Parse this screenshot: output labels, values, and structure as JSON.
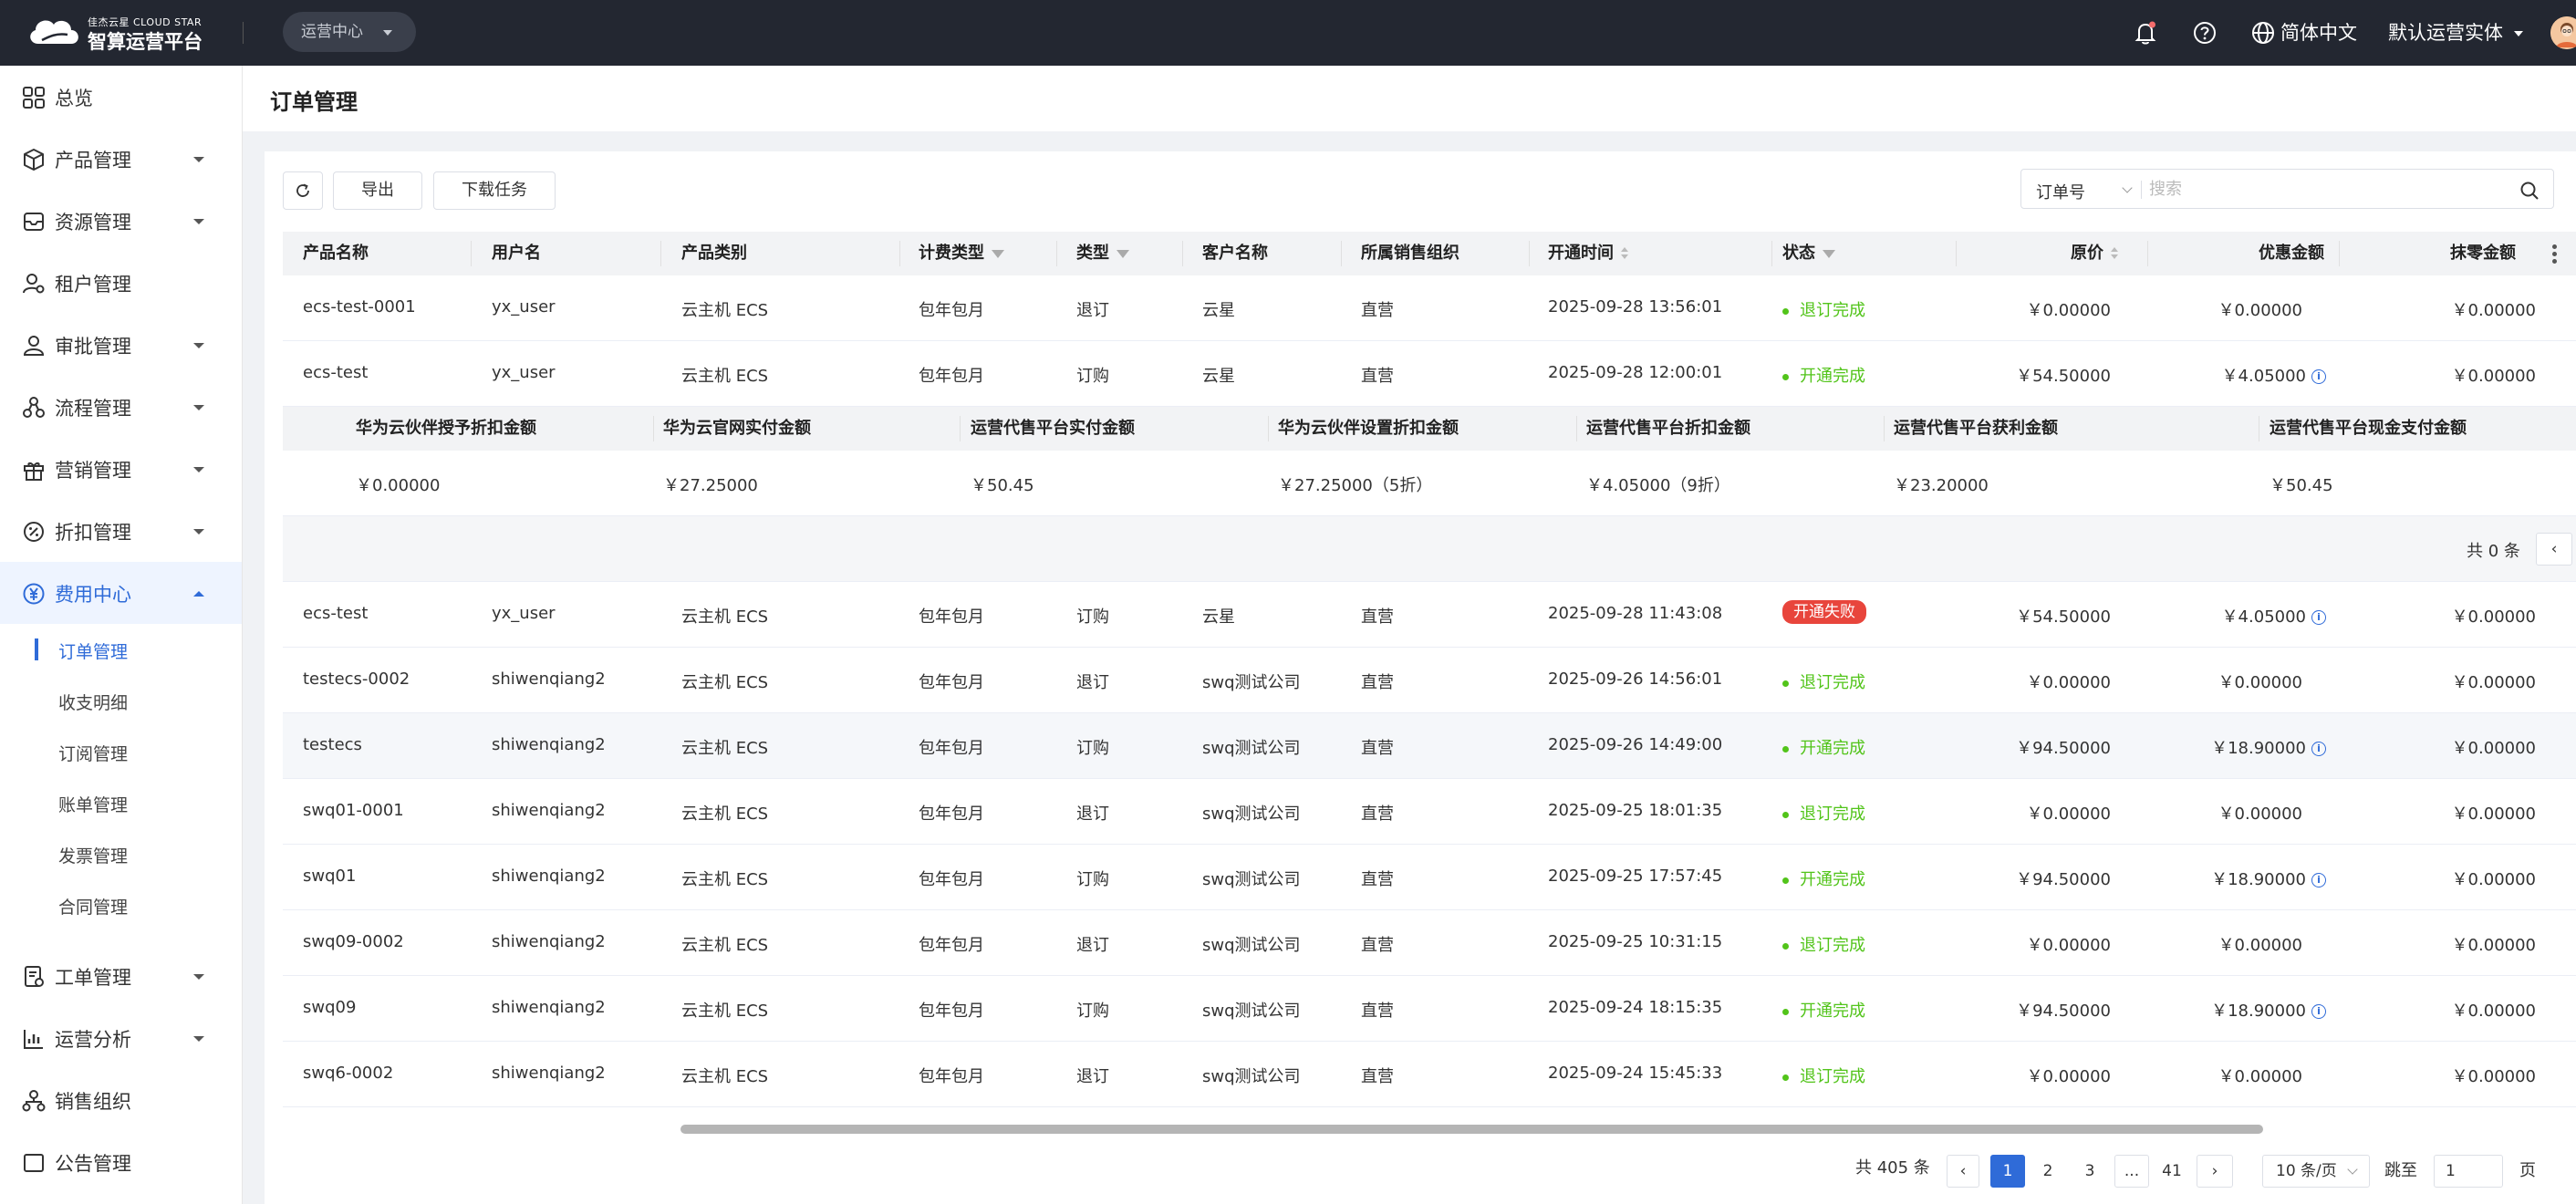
{
  "header": {
    "brand_small": "佳杰云星 CLOUD STAR",
    "brand_name": "智算运营平台",
    "center_switch": "运营中心",
    "language": "简体中文",
    "entity": "默认运营实体"
  },
  "sidebar": {
    "items": [
      {
        "label": "总览",
        "icon": "grid-icon"
      },
      {
        "label": "产品管理",
        "icon": "box-icon"
      },
      {
        "label": "资源管理",
        "icon": "resource-icon"
      },
      {
        "label": "租户管理",
        "icon": "tenant-icon"
      },
      {
        "label": "审批管理",
        "icon": "user-icon"
      },
      {
        "label": "流程管理",
        "icon": "flow-icon"
      },
      {
        "label": "营销管理",
        "icon": "gift-icon"
      },
      {
        "label": "折扣管理",
        "icon": "discount-icon"
      },
      {
        "label": "费用中心",
        "icon": "yen-icon"
      },
      {
        "label": "工单管理",
        "icon": "ticket-icon"
      },
      {
        "label": "运营分析",
        "icon": "chart-icon"
      },
      {
        "label": "销售组织",
        "icon": "org-icon"
      },
      {
        "label": "公告管理",
        "icon": "notice-icon"
      }
    ],
    "sub_items": [
      "订单管理",
      "收支明细",
      "订阅管理",
      "账单管理",
      "发票管理",
      "合同管理"
    ]
  },
  "page": {
    "title": "订单管理"
  },
  "toolbar": {
    "export_label": "导出",
    "download_label": "下载任务",
    "search_type": "订单号",
    "search_placeholder": "搜索"
  },
  "table": {
    "columns": [
      "产品名称",
      "用户名",
      "产品类别",
      "计费类型",
      "类型",
      "客户名称",
      "所属销售组织",
      "开通时间",
      "状态",
      "原价",
      "优惠金额",
      "抹零金额"
    ],
    "rows": [
      {
        "name": "ecs-test-0001",
        "user": "yx_user",
        "category": "云主机 ECS",
        "billing": "包年包月",
        "type": "退订",
        "customer": "云星",
        "org": "直营",
        "time": "2025-09-28 13:56:01",
        "status": "退订完成",
        "price": "￥0.00000",
        "discount": "￥0.00000",
        "rounding": "￥0.00000"
      },
      {
        "name": "ecs-test",
        "user": "yx_user",
        "category": "云主机 ECS",
        "billing": "包年包月",
        "type": "订购",
        "customer": "云星",
        "org": "直营",
        "time": "2025-09-28 12:00:01",
        "status": "开通完成",
        "price": "￥54.50000",
        "discount": "￥4.05000",
        "rounding": "￥0.00000"
      },
      {
        "name": "ecs-test",
        "user": "yx_user",
        "category": "云主机 ECS",
        "billing": "包年包月",
        "type": "订购",
        "customer": "云星",
        "org": "直营",
        "time": "2025-09-28 11:43:08",
        "status": "开通失败",
        "price": "￥54.50000",
        "discount": "￥4.05000",
        "rounding": "￥0.00000"
      },
      {
        "name": "testecs-0002",
        "user": "shiwenqiang2",
        "category": "云主机 ECS",
        "billing": "包年包月",
        "type": "退订",
        "customer": "swq测试公司",
        "org": "直营",
        "time": "2025-09-26 14:56:01",
        "status": "退订完成",
        "price": "￥0.00000",
        "discount": "￥0.00000",
        "rounding": "￥0.00000"
      },
      {
        "name": "testecs",
        "user": "shiwenqiang2",
        "category": "云主机 ECS",
        "billing": "包年包月",
        "type": "订购",
        "customer": "swq测试公司",
        "org": "直营",
        "time": "2025-09-26 14:49:00",
        "status": "开通完成",
        "price": "￥94.50000",
        "discount": "￥18.90000",
        "rounding": "￥0.00000"
      },
      {
        "name": "swq01-0001",
        "user": "shiwenqiang2",
        "category": "云主机 ECS",
        "billing": "包年包月",
        "type": "退订",
        "customer": "swq测试公司",
        "org": "直营",
        "time": "2025-09-25 18:01:35",
        "status": "退订完成",
        "price": "￥0.00000",
        "discount": "￥0.00000",
        "rounding": "￥0.00000"
      },
      {
        "name": "swq01",
        "user": "shiwenqiang2",
        "category": "云主机 ECS",
        "billing": "包年包月",
        "type": "订购",
        "customer": "swq测试公司",
        "org": "直营",
        "time": "2025-09-25 17:57:45",
        "status": "开通完成",
        "price": "￥94.50000",
        "discount": "￥18.90000",
        "rounding": "￥0.00000"
      },
      {
        "name": "swq09-0002",
        "user": "shiwenqiang2",
        "category": "云主机 ECS",
        "billing": "包年包月",
        "type": "退订",
        "customer": "swq测试公司",
        "org": "直营",
        "time": "2025-09-25 10:31:15",
        "status": "退订完成",
        "price": "￥0.00000",
        "discount": "￥0.00000",
        "rounding": "￥0.00000"
      },
      {
        "name": "swq09",
        "user": "shiwenqiang2",
        "category": "云主机 ECS",
        "billing": "包年包月",
        "type": "订购",
        "customer": "swq测试公司",
        "org": "直营",
        "time": "2025-09-24 18:15:35",
        "status": "开通完成",
        "price": "￥94.50000",
        "discount": "￥18.90000",
        "rounding": "￥0.00000"
      },
      {
        "name": "swq6-0002",
        "user": "shiwenqiang2",
        "category": "云主机 ECS",
        "billing": "包年包月",
        "type": "退订",
        "customer": "swq测试公司",
        "org": "直营",
        "time": "2025-09-24 15:45:33",
        "status": "退订完成",
        "price": "￥0.00000",
        "discount": "￥0.00000",
        "rounding": "￥0.00000"
      }
    ]
  },
  "expanded": {
    "columns": [
      "华为云伙伴授予折扣金额",
      "华为云官网实付金额",
      "运营代售平台实付金额",
      "华为云伙伴设置折扣金额",
      "运营代售平台折扣金额",
      "运营代售平台获利金额",
      "运营代售平台现金支付金额"
    ],
    "values": [
      "￥0.00000",
      "￥27.25000",
      "￥50.45",
      "￥27.25000（5折）",
      "￥4.05000（9折）",
      "￥23.20000",
      "￥50.45"
    ],
    "total": "共 0 条"
  },
  "pagination": {
    "total": "共 405 条",
    "pages": [
      "1",
      "2",
      "3",
      "...",
      "41"
    ],
    "page_size": "10 条/页",
    "jump_label": "跳至",
    "jump_value": "1",
    "page_suffix": "页"
  },
  "colors": {
    "accent": "#2f6bd8",
    "success": "#52c41a",
    "danger": "#e8453c",
    "topbar": "#232731"
  }
}
